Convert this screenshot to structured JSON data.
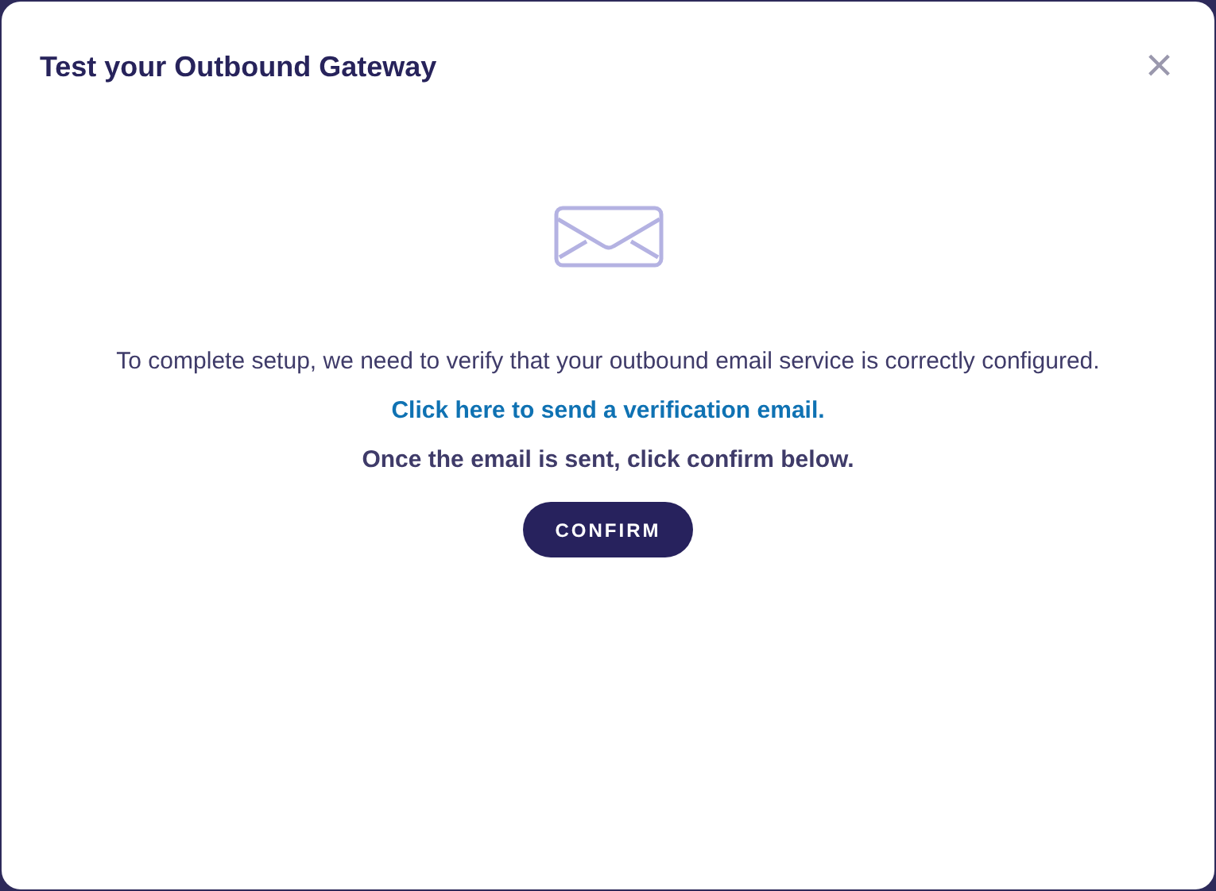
{
  "dialog": {
    "title": "Test your Outbound Gateway",
    "close": "×"
  },
  "body": {
    "message": "To complete setup, we need to verify that your outbound email service is correctly configured.",
    "link": "Click here to send a verification email.",
    "instruction": "Once the email is sent, click confirm below.",
    "button": "CONFIRM"
  }
}
